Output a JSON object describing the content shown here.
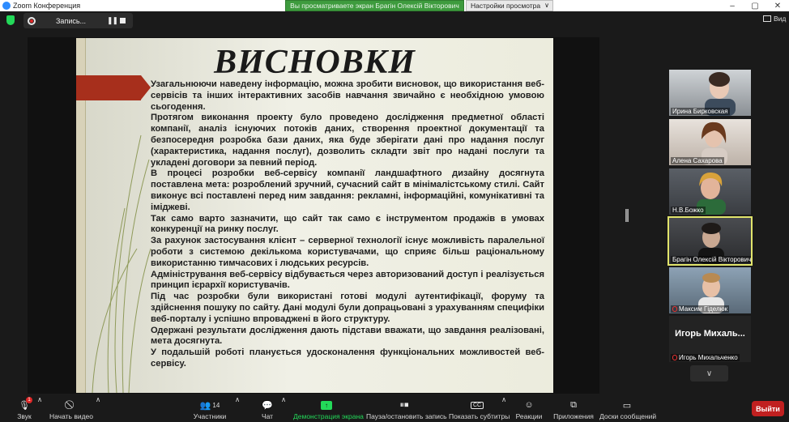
{
  "window": {
    "title": "Zoom Конференция"
  },
  "share_banner": {
    "text": "Вы просматриваете экран Брагін Олексій Вікторович"
  },
  "view_options": {
    "label": "Настройки просмотра"
  },
  "recording": {
    "label": "Запись..."
  },
  "view_button": {
    "label": "Вид"
  },
  "slide": {
    "title": "ВИСНОВКИ",
    "paragraphs": [
      "Узагальнюючи наведену інформацію, можна зробити висновок, що використання веб-сервісів та інших інтерактивних засобів навчання звичайно є необхідною умовою сьогодення.",
      "Протягом виконання проекту було проведено дослідження предметної області компанії, аналіз існуючих потоків даних, створення проектної документації та безпосередня розробка бази даних, яка буде зберігати дані про надання послуг (характеристика, надання послуг), дозволить складти звіт про надані послуги та укладені договори за певний період.",
      "В процесі розробки веб-сервісу  компанії ландшафтного дизайну досягнута поставлена мета: розроблений зручний, сучасний сайт в мінімалістському стилі. Сайт виконує всі поставлені перед ним завдання: рекламні, інформаційні, комунікативні та іміджеві.",
      "Так само варто зазначити, що сайт так само є інструментом продажів в умовах конкуренції на ринку послуг.",
      "За рахунок застосування клієнт – серверної технології існує можливість паралельної роботи з системою декількома користувачами, що сприяє більш раціональному використанню тимчасових і людських ресурсів.",
      "Адміністрування веб-сервісу відбувається через авторизований доступ і реалізується принцип ієрархії користувачів.",
      "Під час розробки були використані готові модулі аутентифікації, форуму та здійснення пошуку по сайту. Дані модулі були допрацьовані з урахуванням специфіки веб-порталу і успішно впроваджені в його структуру.",
      "Одержані результати дослідження дають підстави вважати, що завдання реалізовані, мета досягнута.",
      "У подальшій роботі планується удосконалення функціональних можливостей веб-сервісу."
    ]
  },
  "participants": [
    {
      "name": "Ирина Бирковская",
      "muted": false
    },
    {
      "name": "Алена Сахарова",
      "muted": false
    },
    {
      "name": "Н.В.Божко",
      "muted": false
    },
    {
      "name": "Брагін Олексій Вікторович",
      "muted": false
    },
    {
      "name": "Максим Гіделюк",
      "muted": true
    },
    {
      "name": "Игорь Михальченко",
      "display": "Игорь  Михаль...",
      "muted": true
    }
  ],
  "toolbar": {
    "audio": "Звук",
    "video": "Начать видео",
    "participants": "Участники",
    "participants_count": "14",
    "chat": "Чат",
    "share": "Демонстрация экрана",
    "record": "Пауза/остановить запись",
    "subtitles": "Показать субтитры",
    "reactions": "Реакции",
    "apps": "Приложения",
    "whiteboard": "Доски сообщений",
    "leave": "Выйти",
    "audio_badge": "1"
  },
  "colors": {
    "accent_green": "#23d959",
    "leave_red": "#c02020",
    "active_speaker": "#e1e46b",
    "slide_bar": "#a72f1c"
  }
}
